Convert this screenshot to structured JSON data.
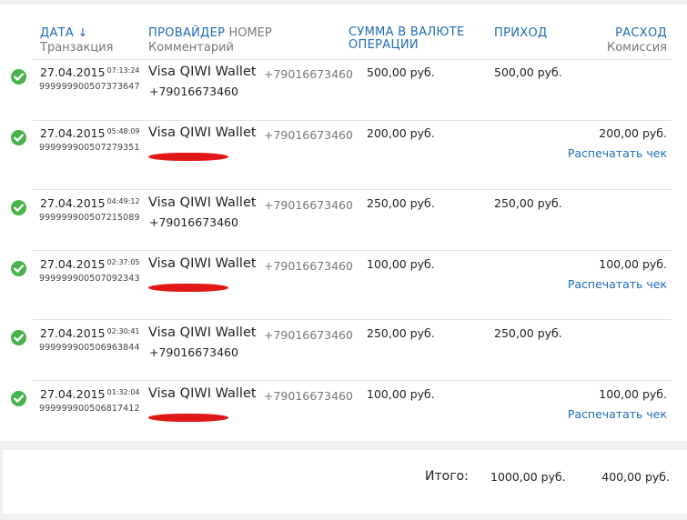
{
  "header": {
    "date": "ДАТА ↓",
    "transaction": "Транзакция",
    "provider": "ПРОВАЙДЕР",
    "number": "НОМЕР",
    "comment": "Комментарий",
    "sum_line1": "СУММА В ВАЛЮТЕ",
    "sum_line2": "ОПЕРАЦИИ",
    "income": "ПРИХОД",
    "expense": "РАСХОД",
    "commission": "Комиссия"
  },
  "rows": [
    {
      "date": "27.04.2015",
      "time": "07:13:24",
      "txid": "999999900507373647",
      "provider": "Visa QIWI Wallet",
      "phone": "+79016673460",
      "comment": "+79016673460",
      "redacted": false,
      "sum": "500,00 руб.",
      "income": "500,00 руб.",
      "expense": "",
      "print": ""
    },
    {
      "date": "27.04.2015",
      "time": "05:48:09",
      "txid": "999999900507279351",
      "provider": "Visa QIWI Wallet",
      "phone": "+79016673460",
      "comment": "",
      "redacted": true,
      "sum": "200,00 руб.",
      "income": "",
      "expense": "200,00 руб.",
      "print": "Распечатать чек"
    },
    {
      "date": "27.04.2015",
      "time": "04:49:12",
      "txid": "999999900507215089",
      "provider": "Visa QIWI Wallet",
      "phone": "+79016673460",
      "comment": "+79016673460",
      "redacted": false,
      "sum": "250,00 руб.",
      "income": "250,00 руб.",
      "expense": "",
      "print": ""
    },
    {
      "date": "27.04.2015",
      "time": "02:37:05",
      "txid": "999999900507092343",
      "provider": "Visa QIWI Wallet",
      "phone": "+79016673460",
      "comment": "",
      "redacted": true,
      "sum": "100,00 руб.",
      "income": "",
      "expense": "100,00 руб.",
      "print": "Распечатать чек"
    },
    {
      "date": "27.04.2015",
      "time": "02:30:41",
      "txid": "999999900506963844",
      "provider": "Visa QIWI Wallet",
      "phone": "+79016673460",
      "comment": "+79016673460",
      "redacted": false,
      "sum": "250,00 руб.",
      "income": "250,00 руб.",
      "expense": "",
      "print": ""
    },
    {
      "date": "27.04.2015",
      "time": "01:32:04",
      "txid": "999999900506817412",
      "provider": "Visa QIWI Wallet",
      "phone": "+79016673460",
      "comment": "",
      "redacted": true,
      "sum": "100,00 руб.",
      "income": "",
      "expense": "100,00 руб.",
      "print": "Распечатать чек"
    }
  ],
  "totals": {
    "label": "Итого:",
    "income": "1000,00 руб.",
    "expense": "400,00 руб."
  },
  "colors": {
    "link": "#1f6bb5",
    "success": "#47b34a",
    "redaction": "#e01818"
  },
  "icons": {
    "status": "check-circle-icon"
  }
}
